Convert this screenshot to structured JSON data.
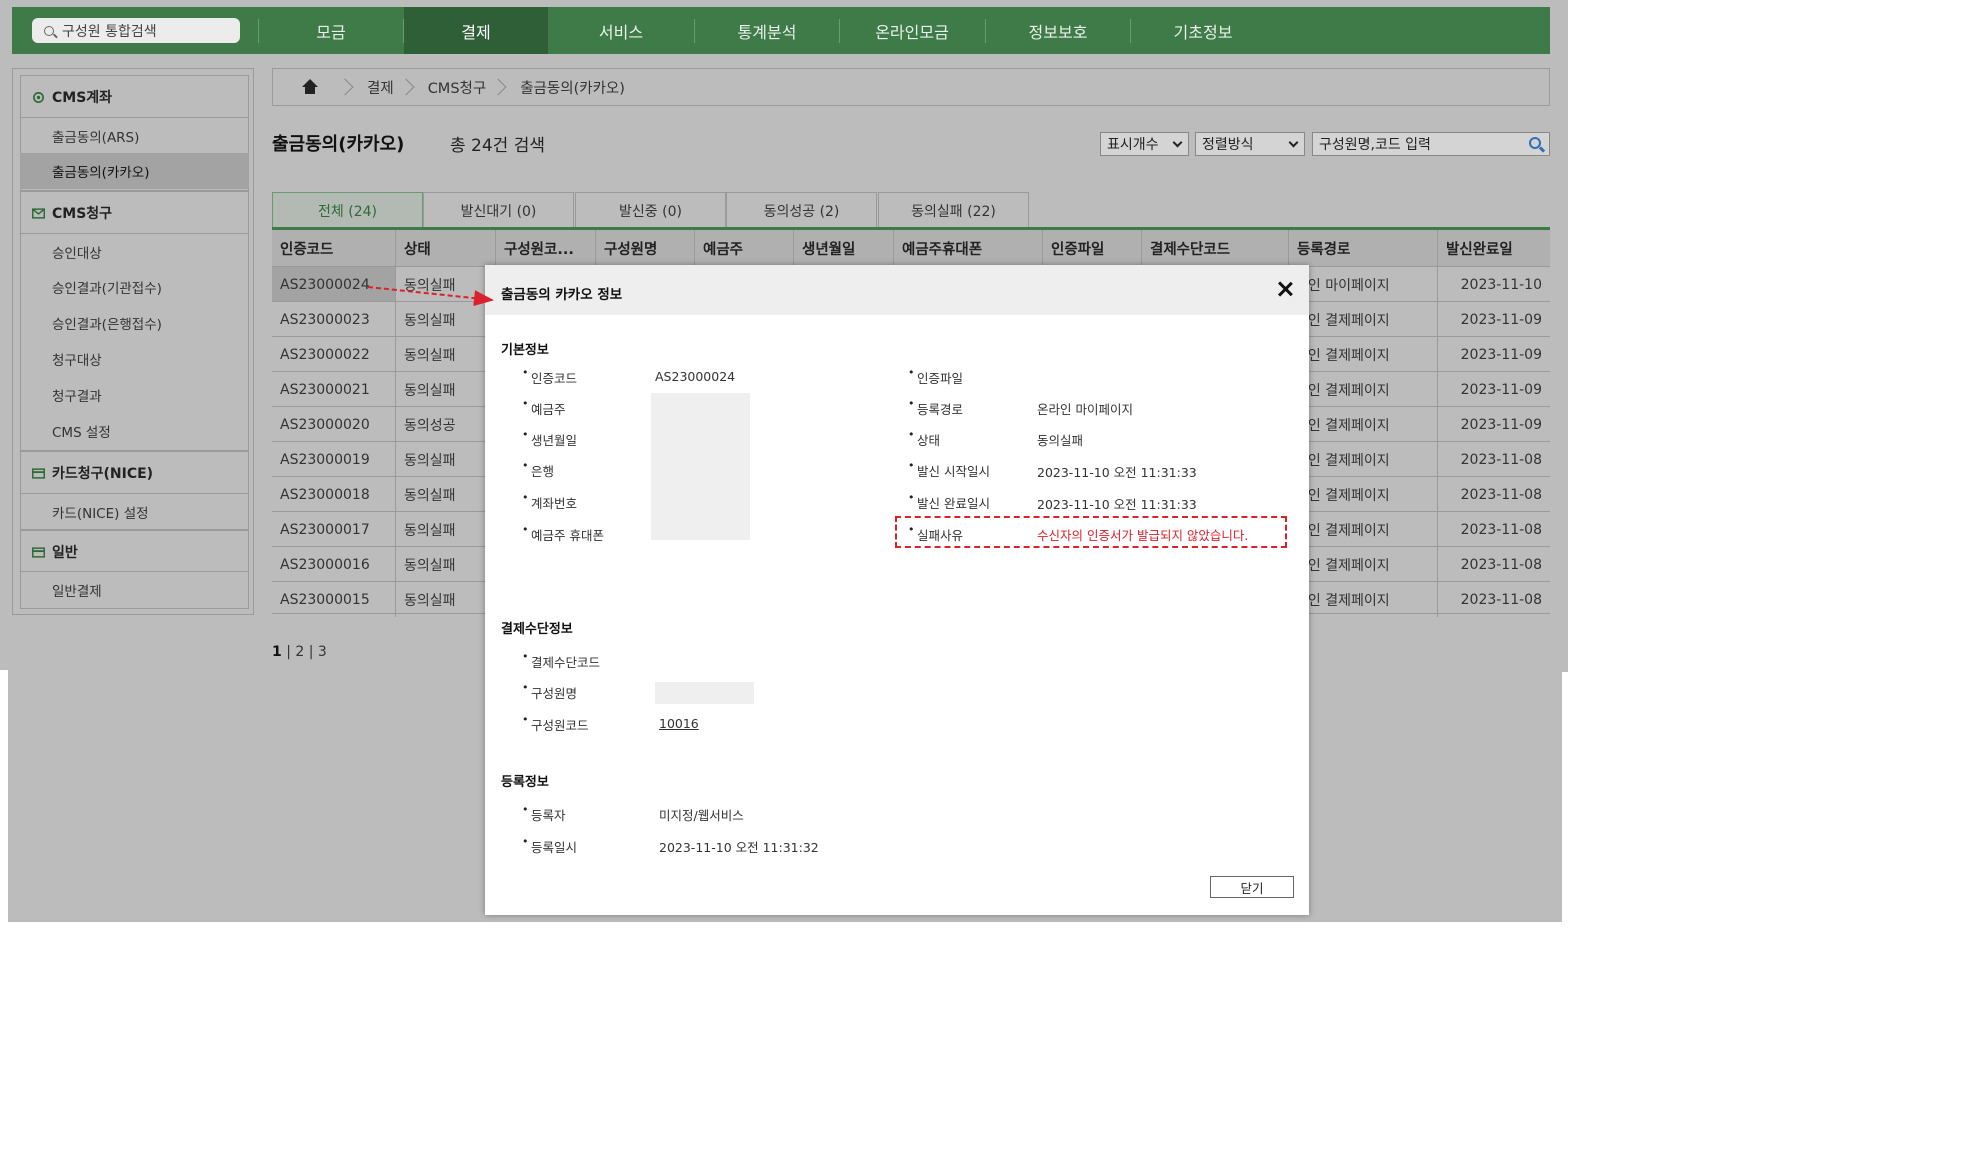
{
  "topnav": {
    "search_placeholder": "구성원 통합검색",
    "items": [
      "모금",
      "결제",
      "서비스",
      "통계분석",
      "온라인모금",
      "정보보호",
      "기초정보"
    ],
    "active_index": 1
  },
  "sidebar": {
    "sections": [
      {
        "title": "CMS계좌",
        "items": [
          "출금동의(ARS)",
          "출금동의(카카오)"
        ]
      },
      {
        "title": "CMS청구",
        "items": [
          "승인대상",
          "승인결과(기관접수)",
          "승인결과(은행접수)",
          "청구대상",
          "청구결과",
          "CMS 설정"
        ]
      },
      {
        "title": "카드청구(NICE)",
        "items": [
          "카드(NICE) 설정"
        ]
      },
      {
        "title": "일반",
        "items": [
          "일반결제"
        ]
      }
    ],
    "active_item": "출금동의(카카오)"
  },
  "breadcrumb": [
    "결제",
    "CMS청구",
    "출금동의(카카오)"
  ],
  "page": {
    "title": "출금동의(카카오)",
    "total": "총 24건 검색",
    "display_count_label": "표시개수",
    "sort_label": "정렬방식",
    "search_placeholder": "구성원명,코드 입력"
  },
  "tabs": [
    {
      "label": "전체 (24)",
      "active": true
    },
    {
      "label": "발신대기 (0)",
      "active": false
    },
    {
      "label": "발신중 (0)",
      "active": false
    },
    {
      "label": "동의성공 (2)",
      "active": false
    },
    {
      "label": "동의실패 (22)",
      "active": false
    }
  ],
  "table": {
    "headers": [
      "인증코드",
      "상태",
      "구성원코...",
      "구성원명",
      "예금주",
      "생년월일",
      "예금주휴대폰",
      "인증파일",
      "결제수단코드",
      "등록경로",
      "발신완료일"
    ],
    "rows": [
      {
        "code": "AS23000024",
        "status": "동의실패",
        "route": "라인 마이페이지",
        "date": "2023-11-10"
      },
      {
        "code": "AS23000023",
        "status": "동의실패",
        "route": "라인 결제페이지",
        "date": "2023-11-09"
      },
      {
        "code": "AS23000022",
        "status": "동의실패",
        "route": "라인 결제페이지",
        "date": "2023-11-09"
      },
      {
        "code": "AS23000021",
        "status": "동의실패",
        "route": "라인 결제페이지",
        "date": "2023-11-09"
      },
      {
        "code": "AS23000020",
        "status": "동의성공",
        "route": "라인 결제페이지",
        "date": "2023-11-09"
      },
      {
        "code": "AS23000019",
        "status": "동의실패",
        "route": "라인 결제페이지",
        "date": "2023-11-08"
      },
      {
        "code": "AS23000018",
        "status": "동의실패",
        "route": "라인 결제페이지",
        "date": "2023-11-08"
      },
      {
        "code": "AS23000017",
        "status": "동의실패",
        "route": "라인 결제페이지",
        "date": "2023-11-08"
      },
      {
        "code": "AS23000016",
        "status": "동의실패",
        "route": "라인 결제페이지",
        "date": "2023-11-08"
      },
      {
        "code": "AS23000015",
        "status": "동의실패",
        "route": "라인 결제페이지",
        "date": "2023-11-08"
      }
    ]
  },
  "pagination": {
    "current": "1",
    "others": [
      "2",
      "3"
    ]
  },
  "modal": {
    "title": "출금동의 카카오 정보",
    "basic_title": "기본정보",
    "basic_left": [
      {
        "label": "인증코드",
        "value": "AS23000024"
      },
      {
        "label": "예금주",
        "value": ""
      },
      {
        "label": "생년월일",
        "value": ""
      },
      {
        "label": "은행",
        "value": ""
      },
      {
        "label": "계좌번호",
        "value": ""
      },
      {
        "label": "예금주 휴대폰",
        "value": ""
      }
    ],
    "basic_right": [
      {
        "label": "인증파일",
        "value": ""
      },
      {
        "label": "등록경로",
        "value": "온라인 마이페이지"
      },
      {
        "label": "상태",
        "value": "동의실패"
      },
      {
        "label": "발신 시작일시",
        "value": "2023-11-10 오전 11:31:33"
      },
      {
        "label": "발신 완료일시",
        "value": "2023-11-10 오전 11:31:33"
      },
      {
        "label": "실패사유",
        "value": "수신자의 인증서가 발급되지 않았습니다."
      }
    ],
    "payment_title": "결제수단정보",
    "payment": [
      {
        "label": "결제수단코드",
        "value": ""
      },
      {
        "label": "구성원명",
        "value": ""
      },
      {
        "label": "구성원코드",
        "value": "10016"
      }
    ],
    "reg_title": "등록정보",
    "reg": [
      {
        "label": "등록자",
        "value": "미지정/웹서비스"
      },
      {
        "label": "등록일시",
        "value": "2023-11-10 오전 11:31:32"
      }
    ],
    "close_label": "닫기"
  },
  "colors": {
    "nav_green": "#3f7b49",
    "nav_active": "#2f5f37",
    "accent_red": "#d9222b",
    "overlay_gray": "#bcbcbc"
  }
}
